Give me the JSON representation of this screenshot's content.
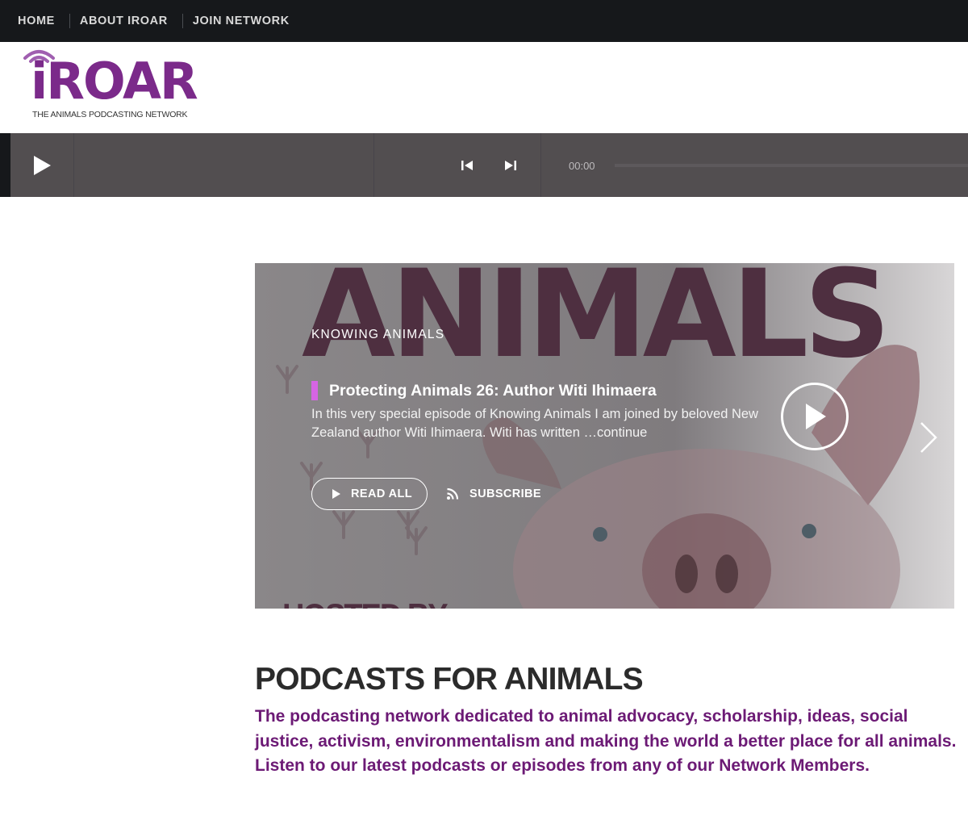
{
  "nav": {
    "items": [
      {
        "label": "HOME"
      },
      {
        "label": "ABOUT IROAR"
      },
      {
        "label": "JOIN NETWORK"
      }
    ]
  },
  "logo": {
    "wordmark": "iROAR",
    "tagline": "THE ANIMALS PODCASTING NETWORK"
  },
  "player": {
    "time": "00:00",
    "progress": 0
  },
  "hero": {
    "background_text": "ANIMALS",
    "background_hosted": "HOSTED BY",
    "kicker": "KNOWING ANIMALS",
    "title": "Protecting Animals 26: Author Witi Ihimaera",
    "excerpt": "In this very special episode of Knowing Animals I am joined by beloved New Zealand author Witi Ihimaera. Witi has written …continue",
    "read_all_label": "READ ALL",
    "subscribe_label": "SUBSCRIBE"
  },
  "section": {
    "heading": "PODCASTS FOR ANIMALS",
    "description": "The podcasting network dedicated to animal advocacy, scholarship, ideas, social justice, activism, environmentalism and making the world a better place for all animals. Listen to our latest podcasts or episodes from any of our Network Members."
  },
  "colors": {
    "nav_bg": "#16181b",
    "player_bg": "#524e50",
    "brand_purple": "#7b2a8a",
    "accent_pink": "#d665e4",
    "description_purple": "#6c1a75"
  },
  "icons": [
    "play-icon",
    "previous-icon",
    "next-icon",
    "rss-icon",
    "chevron-right-icon",
    "broadcast-waves-icon"
  ]
}
